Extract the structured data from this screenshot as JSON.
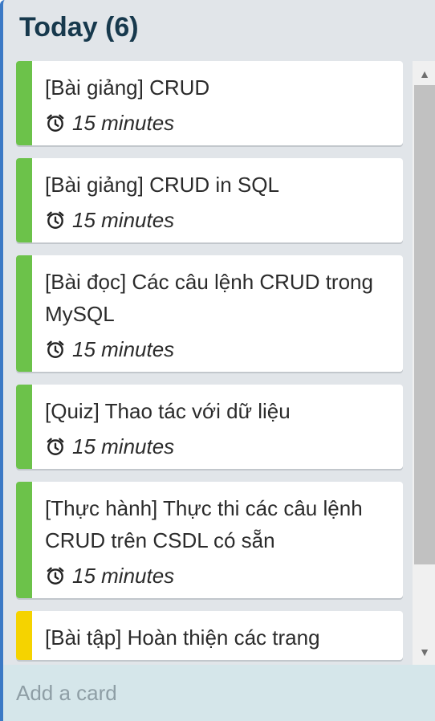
{
  "list": {
    "title": "Today (6)",
    "add_card_label": "Add a card"
  },
  "cards": [
    {
      "title": "[Bài giảng] CRUD",
      "time": "15 minutes",
      "label_color": "#6cc24a"
    },
    {
      "title": "[Bài giảng] CRUD in SQL",
      "time": "15 minutes",
      "label_color": "#6cc24a"
    },
    {
      "title": "[Bài đọc] Các câu lệnh CRUD trong MySQL",
      "time": "15 minutes",
      "label_color": "#6cc24a"
    },
    {
      "title": "[Quiz] Thao tác với dữ liệu",
      "time": "15 minutes",
      "label_color": "#6cc24a"
    },
    {
      "title": "[Thực hành] Thực thi các câu lệnh CRUD trên CSDL có sẵn",
      "time": "15 minutes",
      "label_color": "#6cc24a"
    },
    {
      "title": "[Bài tập] Hoàn thiện các trang",
      "time": "",
      "label_color": "#f5d300"
    }
  ],
  "icons": {
    "time": "alarm-clock-icon",
    "scroll_up": "scroll-up-arrow-icon",
    "scroll_down": "scroll-down-arrow-icon"
  }
}
